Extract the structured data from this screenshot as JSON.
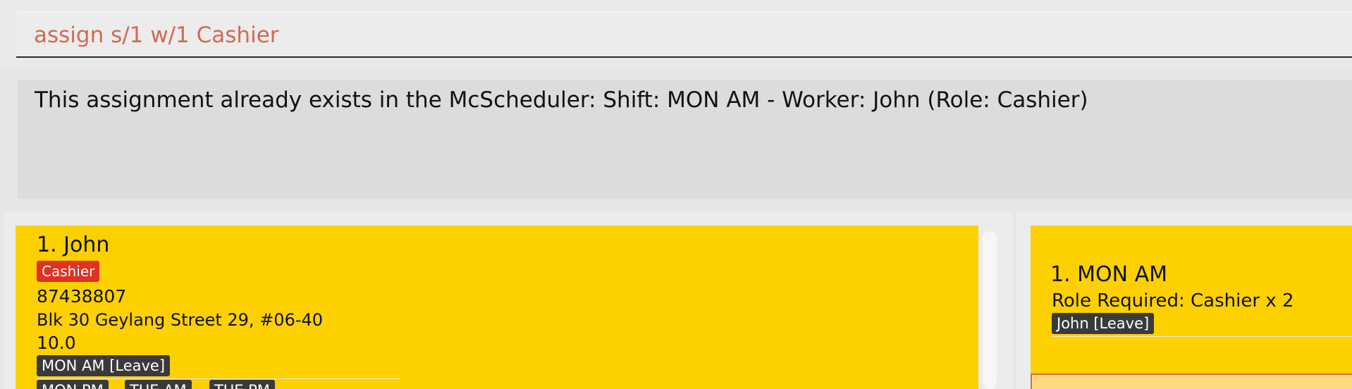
{
  "command": {
    "text": "assign s/1 w/1 Cashier"
  },
  "result": {
    "message": "This assignment already exists in the McScheduler: Shift: MON AM - Worker: John (Role: Cashier)"
  },
  "workers": [
    {
      "index_name": "1.  John",
      "role": "Cashier",
      "phone": "87438807",
      "address": "Blk 30 Geylang Street 29, #06-40",
      "pay": "10.0",
      "leave_tag": "MON AM [Leave]",
      "availability": [
        "MON PM",
        "TUE AM",
        "TUE PM"
      ]
    }
  ],
  "shifts": [
    {
      "index_name": "1.  MON AM",
      "role_required": "Role Required: Cashier x 2",
      "assignment_tag": "John [Leave]"
    }
  ],
  "colors": {
    "card": "#fdd000",
    "role_tag": "#e1321f",
    "dark_tag": "#3a3a3a",
    "command_text": "#d06a55"
  }
}
